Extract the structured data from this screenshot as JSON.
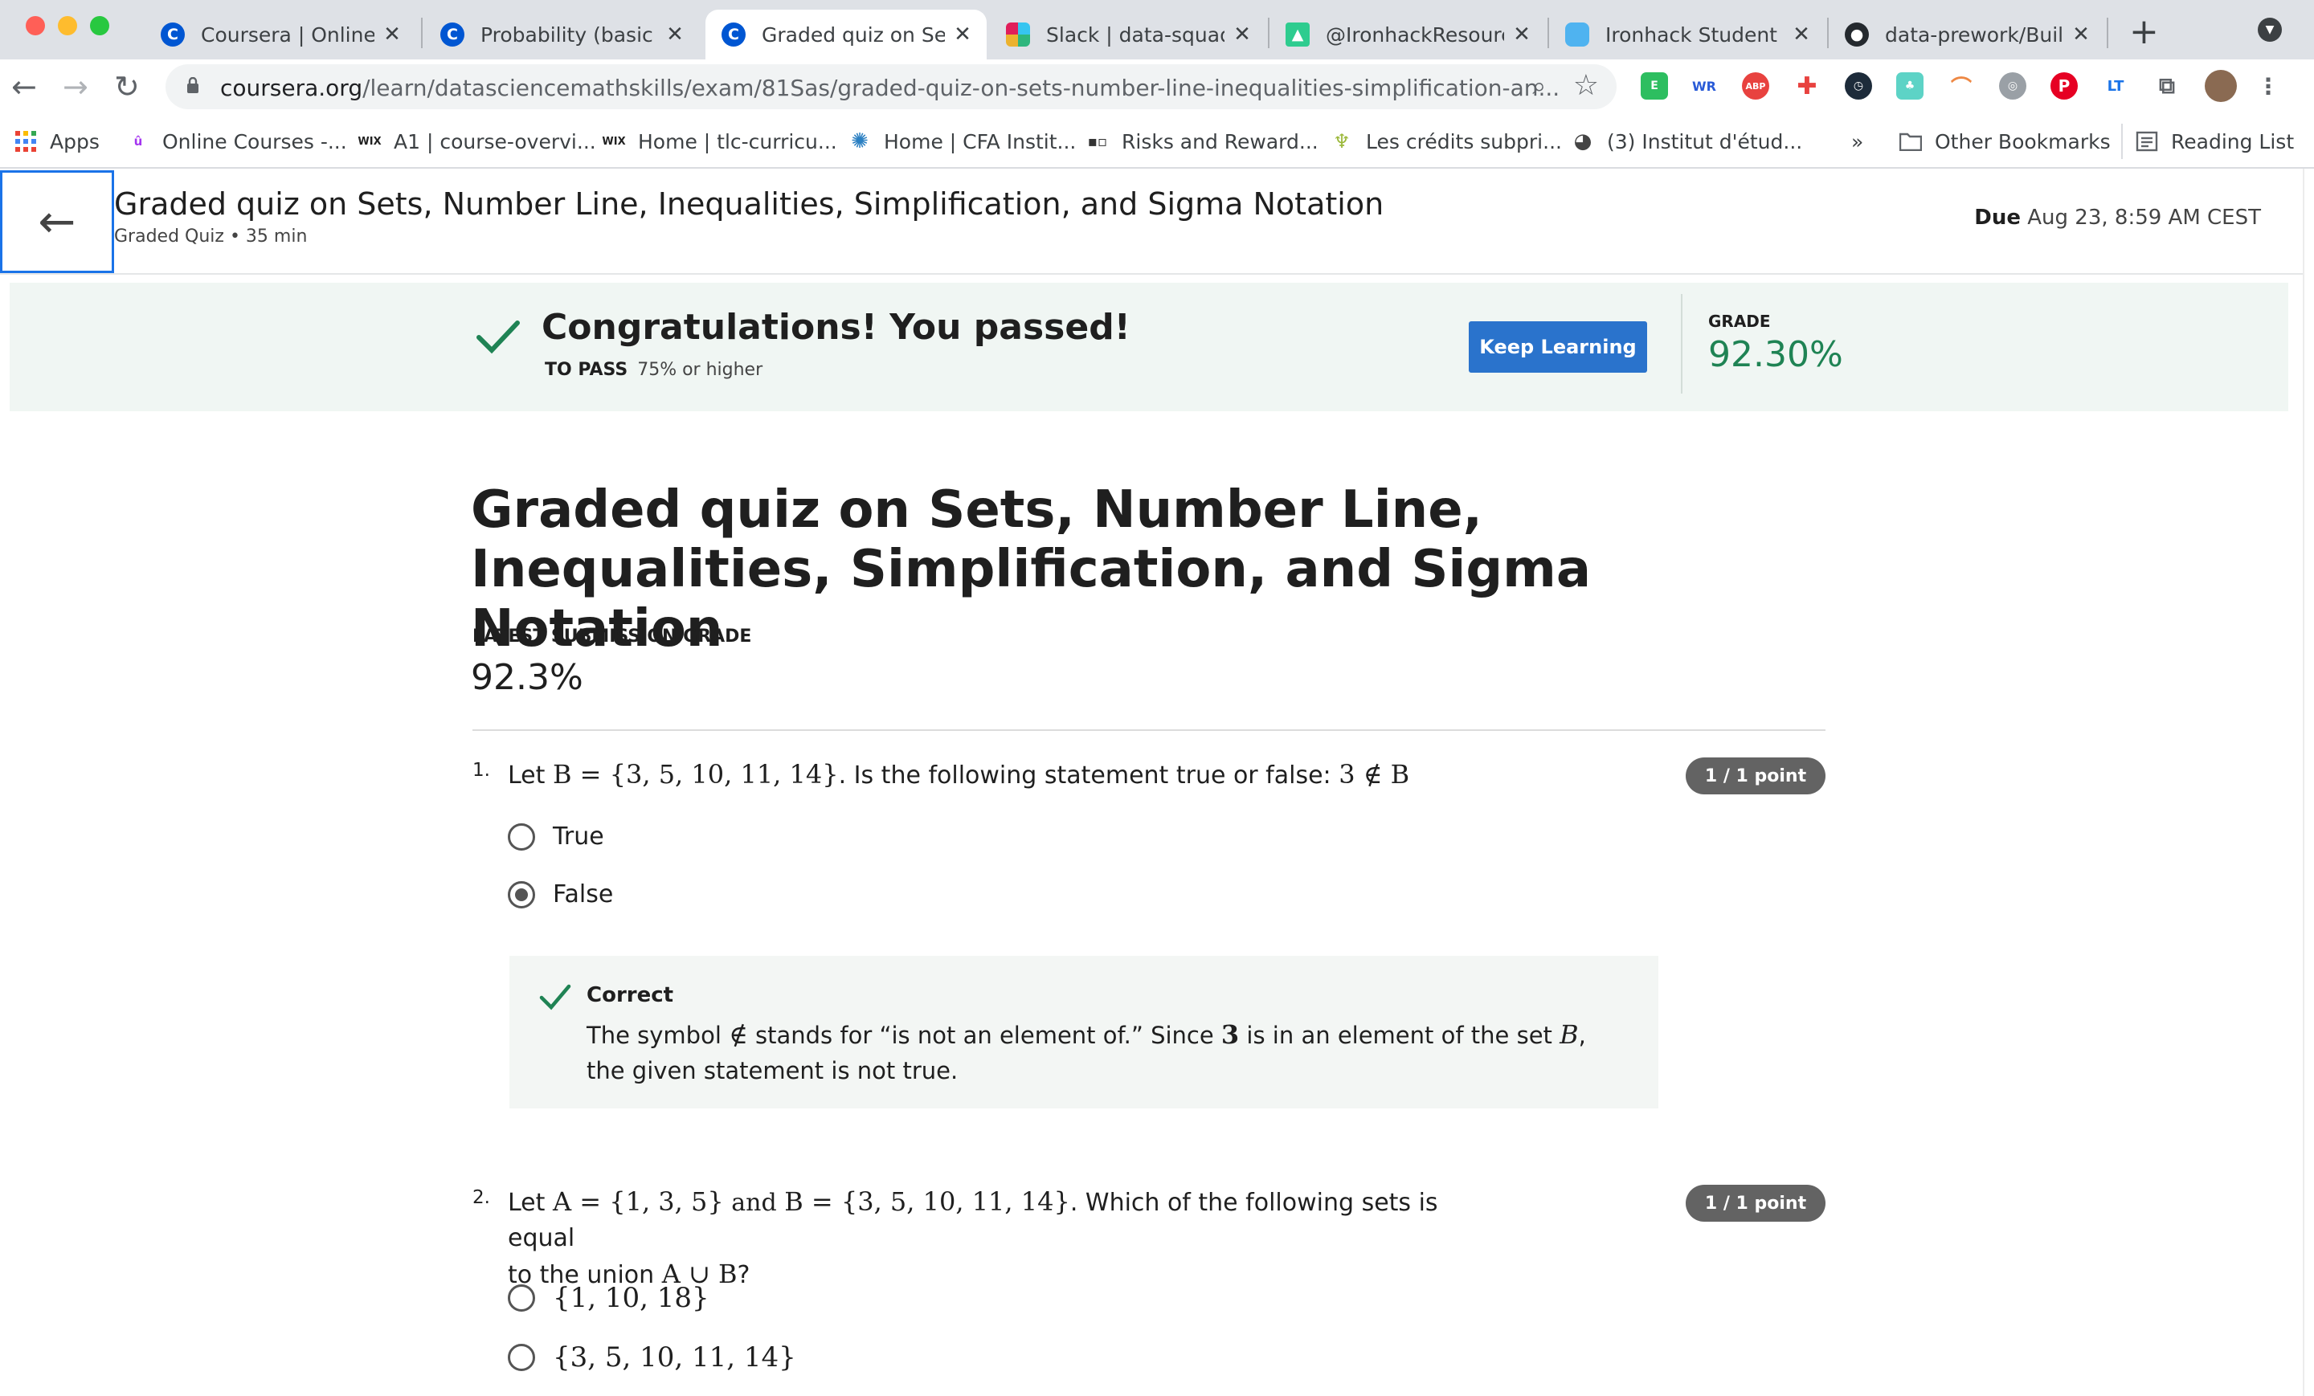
{
  "browser": {
    "tabs": [
      {
        "title": "Coursera | Online C",
        "favicon": "coursera-icon",
        "active": false
      },
      {
        "title": "Probability (basic a",
        "favicon": "coursera-icon",
        "active": false
      },
      {
        "title": "Graded quiz on Set",
        "favicon": "coursera-icon",
        "active": true
      },
      {
        "title": "Slack | data-squad-",
        "favicon": "slack-icon",
        "active": false
      },
      {
        "title": "@IronhackResource",
        "favicon": "tree-icon",
        "active": false
      },
      {
        "title": "Ironhack Student P",
        "favicon": "ironhack-icon",
        "active": false
      },
      {
        "title": "data-prework/Build",
        "favicon": "github-icon",
        "active": false
      }
    ],
    "url_domain": "coursera.org",
    "url_path": "/learn/datasciencemathskills/exam/81Sas/graded-quiz-on-sets-number-line-inequalities-simplification-an...",
    "bookmarks": [
      {
        "label": "Apps",
        "icon": "apps-grid-icon"
      },
      {
        "label": "Online Courses -...",
        "icon": "udemy-icon"
      },
      {
        "label": "A1 | course-overvi...",
        "icon": "wix-icon"
      },
      {
        "label": "Home | tlc-curricu...",
        "icon": "wix-icon"
      },
      {
        "label": "Home | CFA Instit...",
        "icon": "cfa-icon"
      },
      {
        "label": "Risks and Reward...",
        "icon": "bookmark-icon"
      },
      {
        "label": "Les crédits subpri...",
        "icon": "palm-icon"
      },
      {
        "label": "(3) Institut d'étud...",
        "icon": "globe-icon"
      }
    ],
    "bookmarks_overflow": "»",
    "other_bookmarks": "Other Bookmarks",
    "reading_list": "Reading List",
    "extensions": [
      "evernote",
      "wr",
      "abp",
      "medical",
      "clock",
      "tree",
      "rainbow",
      "compass",
      "pinterest",
      "lt",
      "puzzle",
      "avatar",
      "menu"
    ]
  },
  "header": {
    "title": "Graded quiz on Sets, Number Line, Inequalities, Simplification, and Sigma Notation",
    "subtitle": "Graded Quiz • 35 min",
    "due_label": "Due",
    "due_value": "Aug 23, 8:59 AM CEST"
  },
  "banner": {
    "message": "Congratulations! You passed!",
    "to_pass_label": "TO PASS",
    "to_pass_value": "75% or higher",
    "keep_learning": "Keep Learning",
    "grade_label": "GRADE",
    "grade_value": "92.30%"
  },
  "main": {
    "heading": "Graded quiz on Sets, Number Line, Inequalities, Simplification, and Sigma Notation",
    "latest_label": "LATEST SUBMISSION GRADE",
    "latest_value": "92.3%"
  },
  "questions": [
    {
      "number": "1.",
      "text_a": "Let ",
      "math_a": "B = {3, 5, 10, 11, 14}",
      "text_b": ". Is the following statement true or false: ",
      "math_b": "3 ∉ B",
      "points": "1 / 1 point",
      "options": [
        {
          "label": "True",
          "selected": false
        },
        {
          "label": "False",
          "selected": true
        }
      ],
      "feedback_label": "Correct",
      "feedback_a": "The symbol ",
      "feedback_sym": "∉",
      "feedback_b": " stands for “is not an element of.” Since ",
      "feedback_num": "3",
      "feedback_c": " is in an element of the set ",
      "feedback_set": "B",
      "feedback_d": ", the given statement is not true."
    },
    {
      "number": "2.",
      "text_a": "Let ",
      "math_a": "A = {1, 3, 5}",
      "text_and": " and ",
      "math_b": "B = {3, 5, 10, 11, 14}",
      "text_b": ". Which of the following sets is equal",
      "text_c": "to the union ",
      "math_c": "A ∪ B",
      "text_d": "?",
      "points": "1 / 1 point",
      "options": [
        {
          "label": "{1, 10, 18}",
          "selected": false
        },
        {
          "label": "{3, 5, 10, 11, 14}",
          "selected": false
        }
      ]
    }
  ]
}
